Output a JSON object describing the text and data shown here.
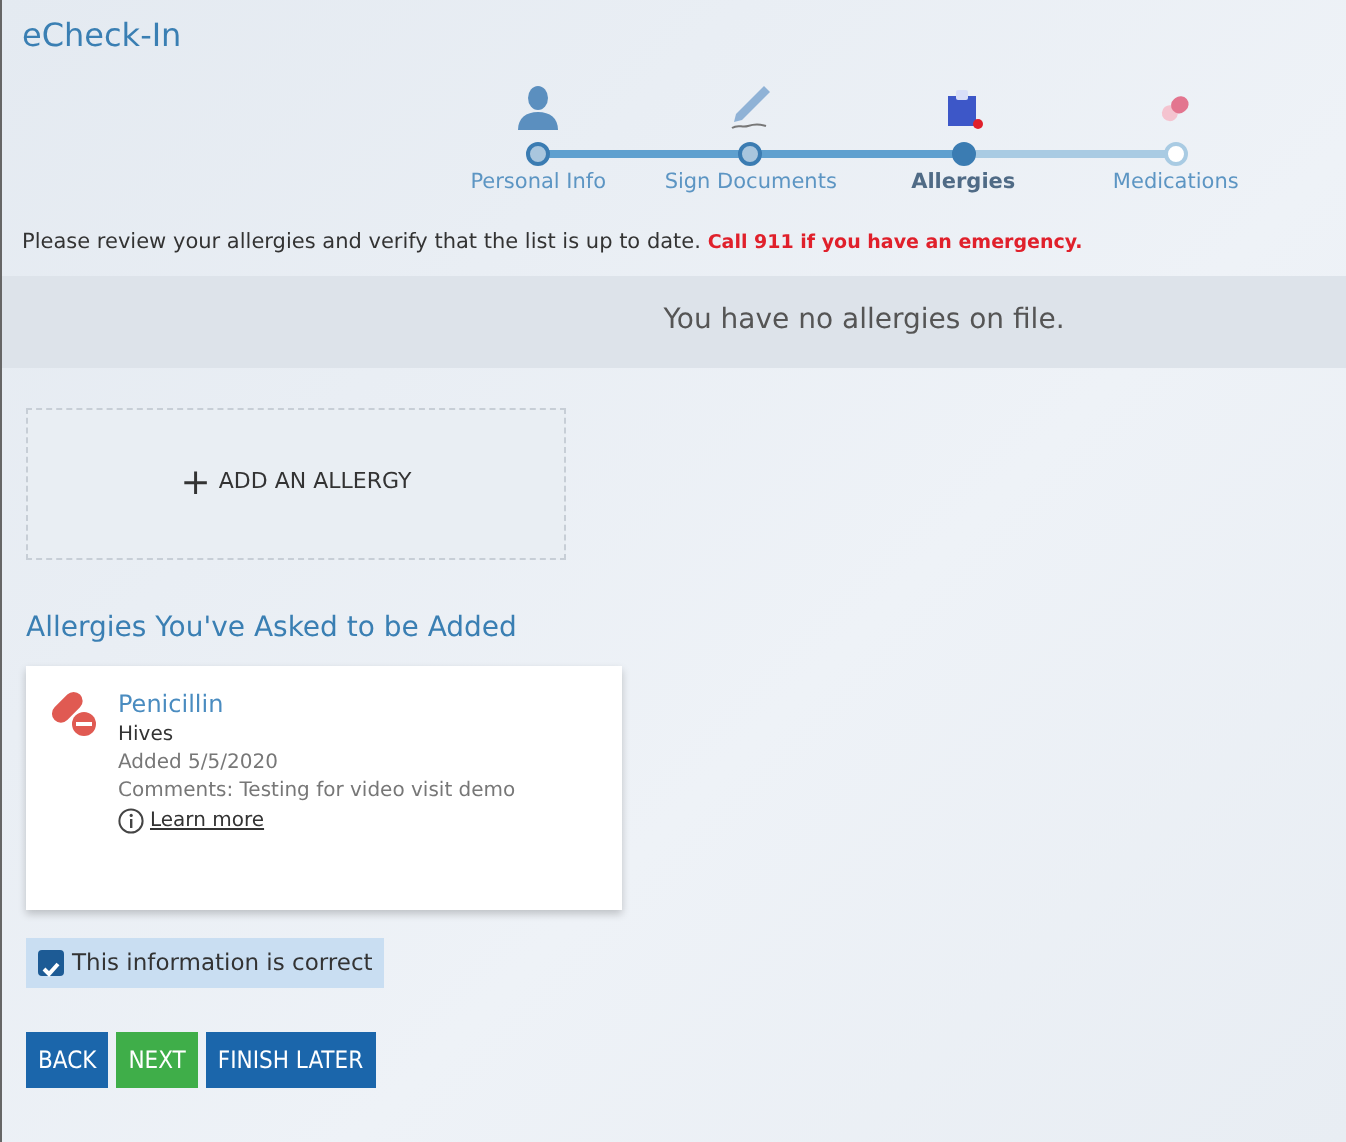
{
  "app_title": "eCheck-In",
  "steps": [
    {
      "label": "Personal Info",
      "kind": "person",
      "done": true,
      "selected": false
    },
    {
      "label": "Sign Documents",
      "kind": "signature",
      "done": true,
      "selected": false
    },
    {
      "label": "Allergies",
      "kind": "allergy",
      "done": true,
      "selected": true
    },
    {
      "label": "Medications",
      "kind": "medication",
      "done": false,
      "selected": false
    }
  ],
  "intro": {
    "text": "Please review your allergies and verify that the list is up to date.",
    "warning": "Call 911 if you have an emergency."
  },
  "empty_message": "You have no allergies on file.",
  "add_button": {
    "icon": "+",
    "label": "ADD AN ALLERGY"
  },
  "requested_heading": "Allergies You've Asked to be Added",
  "requested": [
    {
      "name": "Penicillin",
      "reaction": "Hives",
      "added": "Added 5/5/2020",
      "comments": "Comments: Testing for video visit demo",
      "link": "Learn more"
    }
  ],
  "confirm": {
    "label": "This information is correct",
    "checked": true
  },
  "buttons": [
    {
      "label": "BACK",
      "kind": "primary"
    },
    {
      "label": "NEXT",
      "kind": "success"
    },
    {
      "label": "FINISH LATER",
      "kind": "primary"
    }
  ]
}
